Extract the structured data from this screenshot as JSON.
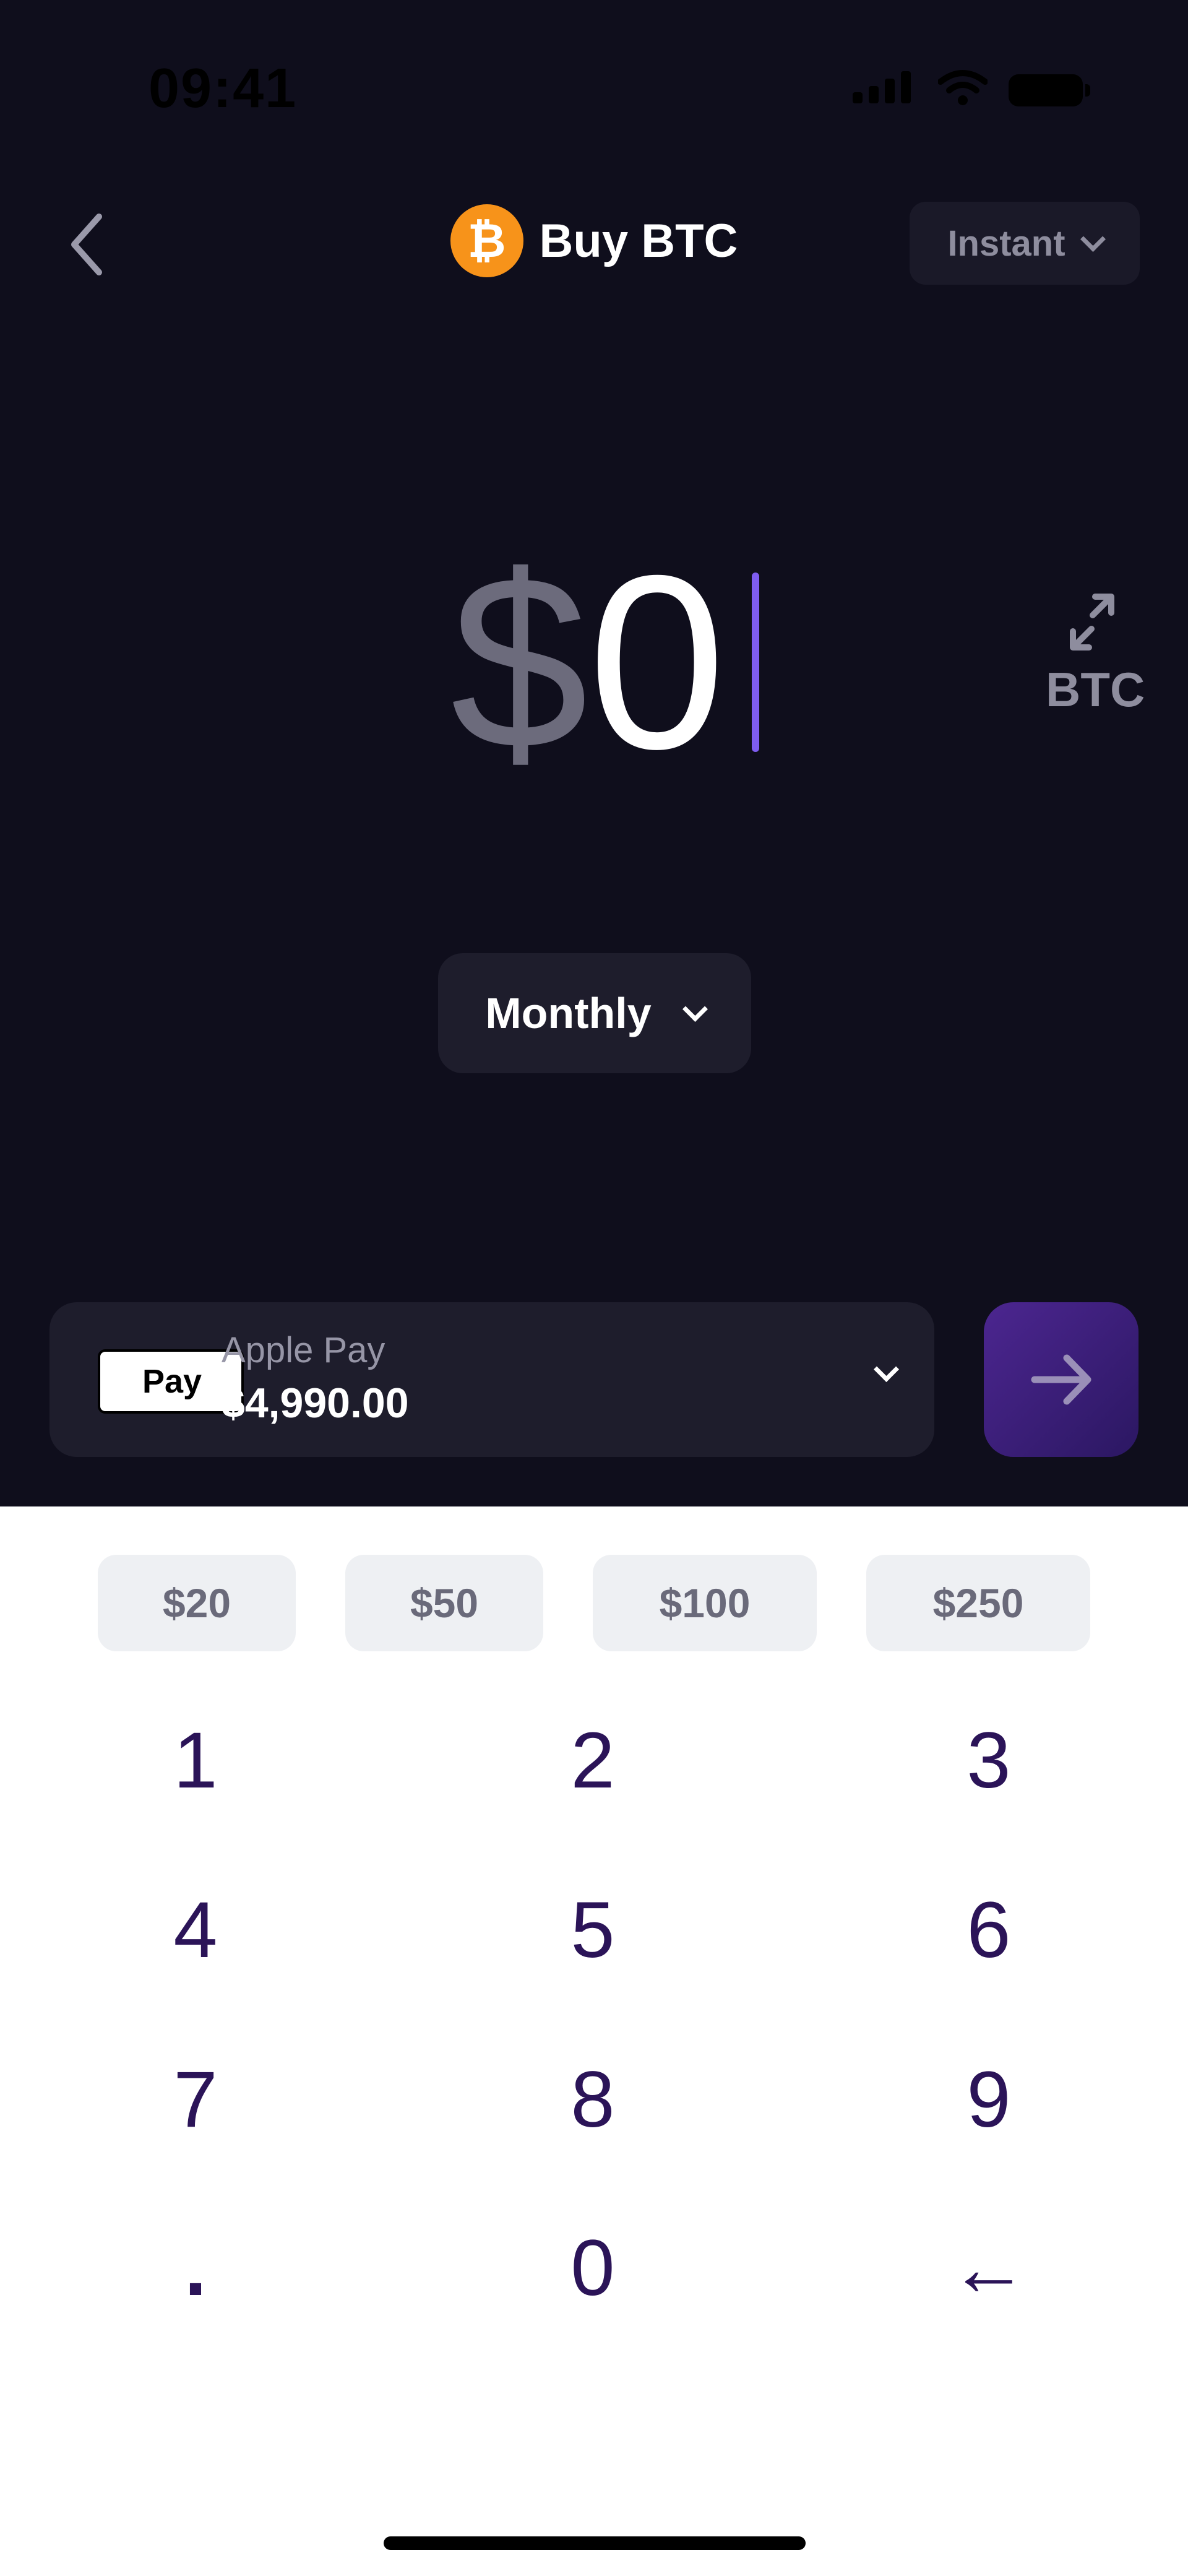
{
  "status": {
    "time": "09:41"
  },
  "header": {
    "title": "Buy BTC",
    "coin_symbol": "₿",
    "speed": "Instant"
  },
  "amount": {
    "currency": "$",
    "value": "0"
  },
  "toggle": {
    "label": "BTC"
  },
  "frequency": {
    "label": "Monthly"
  },
  "payment": {
    "method": "Apple Pay",
    "badge": "Pay",
    "badge_symbol": "",
    "balance": "$4,990.00"
  },
  "presets": [
    "$20",
    "$50",
    "$100",
    "$250"
  ],
  "keypad": [
    "1",
    "2",
    "3",
    "4",
    "5",
    "6",
    "7",
    "8",
    "9",
    ".",
    "0",
    "←"
  ],
  "colors": {
    "accent": "#7e5cf0",
    "bitcoin": "#f7931a",
    "keypad_text": "#2b1458"
  }
}
